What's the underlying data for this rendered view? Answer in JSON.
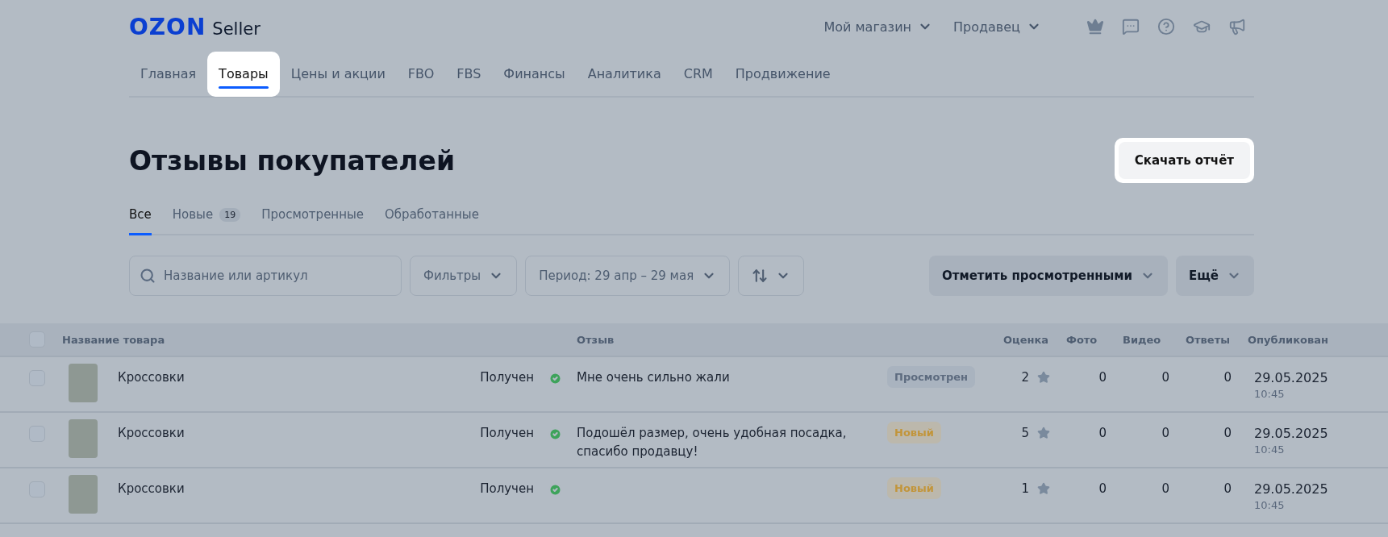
{
  "header": {
    "logo": {
      "brand": "OZON",
      "product": "Seller"
    },
    "menus": [
      {
        "label": "Мой магазин"
      },
      {
        "label": "Продавец"
      }
    ]
  },
  "nav": [
    {
      "label": "Главная",
      "selected": false,
      "highlighted": false
    },
    {
      "label": "Товары",
      "selected": true,
      "highlighted": true
    },
    {
      "label": "Цены и акции",
      "selected": false,
      "highlighted": false
    },
    {
      "label": "FBO",
      "selected": false,
      "highlighted": false
    },
    {
      "label": "FBS",
      "selected": false,
      "highlighted": false
    },
    {
      "label": "Финансы",
      "selected": false,
      "highlighted": false
    },
    {
      "label": "Аналитика",
      "selected": false,
      "highlighted": false
    },
    {
      "label": "CRM",
      "selected": false,
      "highlighted": false
    },
    {
      "label": "Продвижение",
      "selected": false,
      "highlighted": false
    }
  ],
  "page": {
    "title": "Отзывы покупателей",
    "download_button": {
      "label": "Скачать отчёт",
      "highlighted": true
    }
  },
  "review_tabs": [
    {
      "label": "Все",
      "selected": true
    },
    {
      "label": "Новые",
      "count": "19",
      "selected": false
    },
    {
      "label": "Просмотренные",
      "selected": false
    },
    {
      "label": "Обработанные",
      "selected": false
    }
  ],
  "toolbar": {
    "search": {
      "placeholder": "Название или артикул"
    },
    "filters": [
      {
        "kind": "dropdown",
        "label": "Фильтры"
      },
      {
        "kind": "dropdown",
        "label": "Период: 29 апр – 29 мая"
      },
      {
        "kind": "sort"
      }
    ],
    "actions": [
      {
        "label": "Отметить просмотренными"
      },
      {
        "label": "Ещё"
      }
    ]
  },
  "table": {
    "select_all_checked": false,
    "columns": [
      "Название товара",
      "Отзыв",
      "Оценка",
      "Фото",
      "Видео",
      "Ответы",
      "Опубликован"
    ],
    "rows": [
      {
        "checked": false,
        "product": "Кроссовки",
        "status": "Получен",
        "review": "Мне очень сильно жали",
        "badge": {
          "kind": "viewed",
          "label": "Просмотрен"
        },
        "rating": "2",
        "photos": "0",
        "videos": "0",
        "answers": "0",
        "date": "29.05.2025",
        "time": "10:45"
      },
      {
        "checked": false,
        "product": "Кроссовки",
        "status": "Получен",
        "review": "Подошёл размер, очень удобная посадка, спасибо продавцу!",
        "badge": {
          "kind": "new",
          "label": "Новый"
        },
        "rating": "5",
        "photos": "0",
        "videos": "0",
        "answers": "0",
        "date": "29.05.2025",
        "time": "10:45"
      },
      {
        "checked": false,
        "product": "Кроссовки",
        "status": "Получен",
        "badge": {
          "kind": "new",
          "label": "Новый"
        },
        "rating": "1",
        "photos": "0",
        "videos": "0",
        "answers": "0",
        "date": "29.05.2025",
        "time": "10:45"
      }
    ]
  }
}
